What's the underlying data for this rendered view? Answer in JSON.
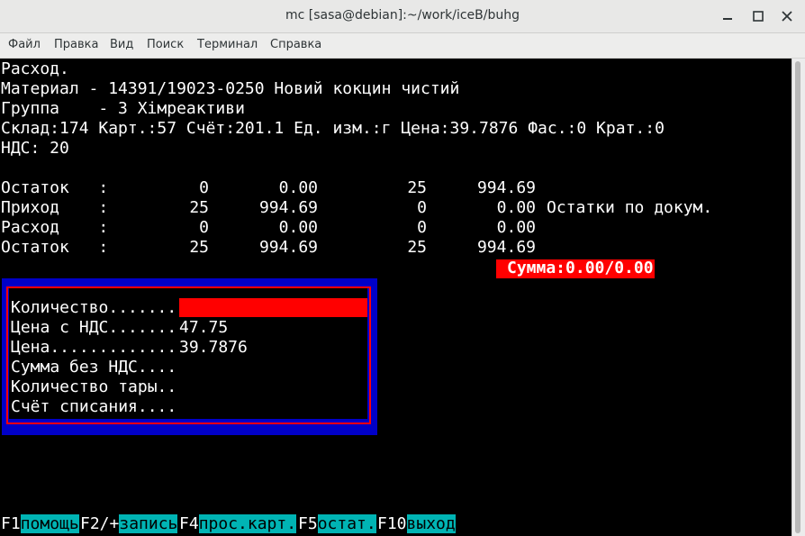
{
  "window": {
    "title": "mc [sasa@debian]:~/work/iceB/buhg"
  },
  "menu": [
    "Файл",
    "Правка",
    "Вид",
    "Поиск",
    "Терминал",
    "Справка"
  ],
  "header": {
    "line1": "Расход.",
    "line2": "Материал - 14391/19023-0250 Новий кокцин чистий",
    "line3": "Группа    - 3 Хімреактиви",
    "line4": "Склад:174 Карт.:57 Счёт:201.1 Ед. изм.:г Цена:39.7876 Фас.:0 Крат.:0",
    "line5": "НДС: 20"
  },
  "balance_rows": [
    {
      "label": "Остаток   :",
      "c1": "0",
      "c2": "0.00",
      "c3": "25",
      "c4": "994.69",
      "note": ""
    },
    {
      "label": "Приход    :",
      "c1": "25",
      "c2": "994.69",
      "c3": "0",
      "c4": "0.00",
      "note": "Остатки по докум."
    },
    {
      "label": "Расход    :",
      "c1": "0",
      "c2": "0.00",
      "c3": "0",
      "c4": "0.00",
      "note": ""
    },
    {
      "label": "Остаток   :",
      "c1": "25",
      "c2": "994.69",
      "c3": "25",
      "c4": "994.69",
      "note": ""
    }
  ],
  "sum_badge": "Сумма:0.00/0.00",
  "dialog": {
    "fields": [
      {
        "label": "Количество.......",
        "value": ""
      },
      {
        "label": "Цена с НДС.......",
        "value": "47.75"
      },
      {
        "label": "Цена.............",
        "value": "39.7876"
      },
      {
        "label": "Сумма без НДС....",
        "value": ""
      },
      {
        "label": "Количество тары..",
        "value": ""
      },
      {
        "label": "Счёт списания....",
        "value": ""
      }
    ]
  },
  "fkeys": [
    {
      "key": "F1",
      "label": "помощь"
    },
    {
      "key": "F2/+",
      "label": "запись"
    },
    {
      "key": "F4",
      "label": "прос.карт."
    },
    {
      "key": "F5",
      "label": "остат."
    },
    {
      "key": "F10",
      "label": "выход"
    }
  ],
  "colors": {
    "terminal_bg": "#000000",
    "dialog_frame": "#0000c8",
    "highlight": "#ff0000",
    "fkey_label_bg": "#00b4b4"
  }
}
